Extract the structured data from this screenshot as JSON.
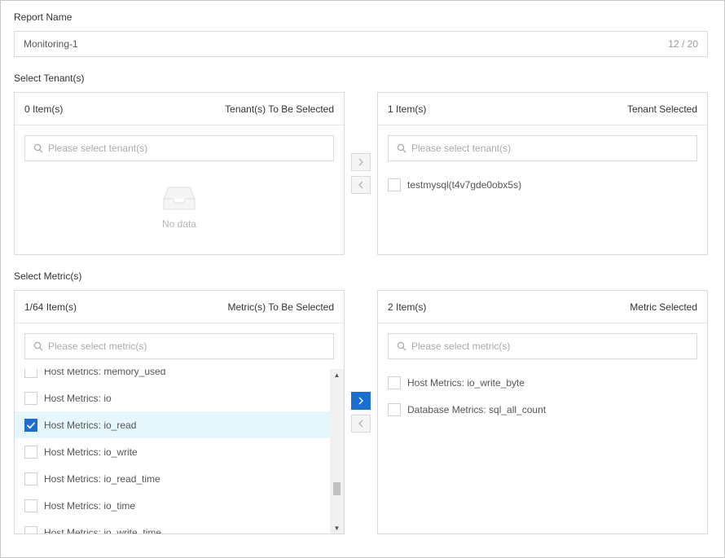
{
  "report_name": {
    "label": "Report Name",
    "value": "Monitoring-1",
    "char_count": "12 / 20"
  },
  "tenant": {
    "section_label": "Select Tenant(s)",
    "left": {
      "count": "0 Item(s)",
      "title": "Tenant(s) To Be Selected",
      "search_placeholder": "Please select tenant(s)",
      "empty_text": "No data"
    },
    "right": {
      "count": "1 Item(s)",
      "title": "Tenant Selected",
      "search_placeholder": "Please select tenant(s)",
      "items": [
        {
          "label": "testmysql(t4v7gde0obx5s)",
          "checked": false
        }
      ]
    },
    "move_right_icon": "chevron-right-icon",
    "move_left_icon": "chevron-left-icon"
  },
  "metric": {
    "section_label": "Select Metric(s)",
    "left": {
      "count": "1/64 Item(s)",
      "title": "Metric(s) To Be Selected",
      "search_placeholder": "Please select metric(s)",
      "items": [
        {
          "label": "Host Metrics: memory_used",
          "checked": false
        },
        {
          "label": "Host Metrics: io",
          "checked": false
        },
        {
          "label": "Host Metrics: io_read",
          "checked": true
        },
        {
          "label": "Host Metrics: io_write",
          "checked": false
        },
        {
          "label": "Host Metrics: io_read_time",
          "checked": false
        },
        {
          "label": "Host Metrics: io_time",
          "checked": false
        },
        {
          "label": "Host Metrics: io_write_time",
          "checked": false
        }
      ]
    },
    "right": {
      "count": "2 Item(s)",
      "title": "Metric Selected",
      "search_placeholder": "Please select metric(s)",
      "items": [
        {
          "label": "Host Metrics: io_write_byte",
          "checked": false
        },
        {
          "label": "Database Metrics: sql_all_count",
          "checked": false
        }
      ]
    }
  },
  "colors": {
    "accent": "#1a6fd1",
    "selected_row": "#e6f6fd",
    "border": "#d9d9d9"
  }
}
